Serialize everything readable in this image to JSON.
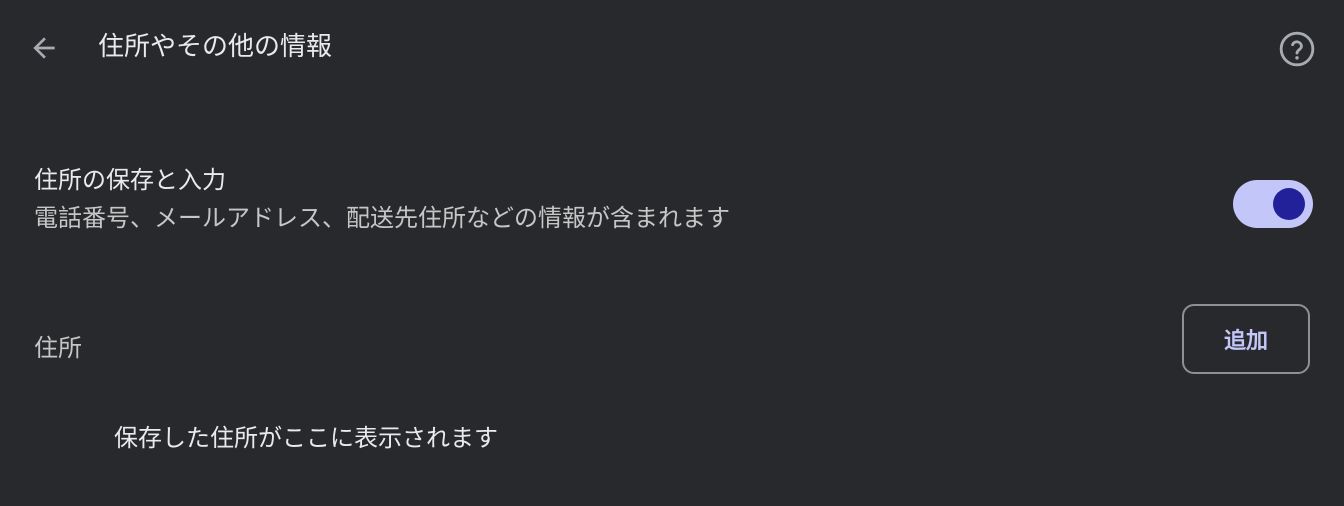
{
  "header": {
    "back_icon": "arrow-left-icon",
    "title": "住所やその他の情報",
    "help_icon": "help-circle-icon"
  },
  "autofill_toggle": {
    "title": "住所の保存と入力",
    "description": "電話番号、メールアドレス、配送先住所などの情報が含まれます",
    "enabled": true,
    "accent": "#c3c6f9",
    "knob": "#22219a"
  },
  "addresses": {
    "label": "住所",
    "add_button_label": "追加",
    "empty_message": "保存した住所がここに表示されます"
  },
  "colors": {
    "background": "#28292d",
    "text_primary": "#e8eaed",
    "text_secondary": "#c4c7c5"
  }
}
